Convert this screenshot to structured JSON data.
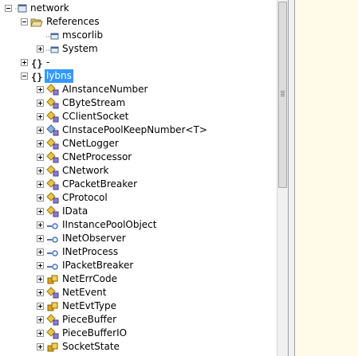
{
  "tree": {
    "rows": [
      {
        "level": 0,
        "expander": "minus",
        "icon": "assembly-icon",
        "label": "network"
      },
      {
        "level": 1,
        "expander": "minus",
        "icon": "folder-open-icon",
        "label": "References"
      },
      {
        "level": 2,
        "expander": "none",
        "icon": "reference-icon",
        "label": "mscorlib"
      },
      {
        "level": 2,
        "expander": "plus",
        "icon": "reference-icon",
        "label": "System"
      },
      {
        "level": 1,
        "expander": "plus",
        "icon": "namespace-icon",
        "label": "-"
      },
      {
        "level": 1,
        "expander": "minus",
        "icon": "namespace-icon",
        "label": "lybns",
        "selected": true
      },
      {
        "level": 2,
        "expander": "plus",
        "icon": "class-icon",
        "label": "AInstanceNumber"
      },
      {
        "level": 2,
        "expander": "plus",
        "icon": "class-icon",
        "label": "CByteStream"
      },
      {
        "level": 2,
        "expander": "plus",
        "icon": "class-icon",
        "label": "CClientSocket"
      },
      {
        "level": 2,
        "expander": "plus",
        "icon": "generic-class-icon",
        "label": "CInstacePoolKeepNumber<T>"
      },
      {
        "level": 2,
        "expander": "plus",
        "icon": "class-icon",
        "label": "CNetLogger"
      },
      {
        "level": 2,
        "expander": "plus",
        "icon": "class-icon",
        "label": "CNetProcessor"
      },
      {
        "level": 2,
        "expander": "plus",
        "icon": "class-icon",
        "label": "CNetwork"
      },
      {
        "level": 2,
        "expander": "plus",
        "icon": "class-icon",
        "label": "CPacketBreaker"
      },
      {
        "level": 2,
        "expander": "plus",
        "icon": "class-icon",
        "label": "CProtocol"
      },
      {
        "level": 2,
        "expander": "plus",
        "icon": "class-icon",
        "label": "IData"
      },
      {
        "level": 2,
        "expander": "plus",
        "icon": "interface-icon",
        "label": "IInstancePoolObject"
      },
      {
        "level": 2,
        "expander": "plus",
        "icon": "interface-icon",
        "label": "INetObserver"
      },
      {
        "level": 2,
        "expander": "plus",
        "icon": "interface-icon",
        "label": "INetProcess"
      },
      {
        "level": 2,
        "expander": "plus",
        "icon": "interface-icon",
        "label": "IPacketBreaker"
      },
      {
        "level": 2,
        "expander": "plus",
        "icon": "enum-icon",
        "label": "NetErrCode"
      },
      {
        "level": 2,
        "expander": "plus",
        "icon": "class-icon",
        "label": "NetEvent"
      },
      {
        "level": 2,
        "expander": "plus",
        "icon": "enum-icon",
        "label": "NetEvtType"
      },
      {
        "level": 2,
        "expander": "plus",
        "icon": "class-icon",
        "label": "PieceBuffer"
      },
      {
        "level": 2,
        "expander": "plus",
        "icon": "class-icon",
        "label": "PieceBufferIO"
      },
      {
        "level": 2,
        "expander": "plus",
        "icon": "enum-icon",
        "label": "SocketState"
      }
    ]
  },
  "colors": {
    "selection": "#3399ff",
    "right_pane": "#fffbe8",
    "class_diamond": "#e8c44a",
    "class_cube": "#8a7ec9",
    "interface": "#4a73b0",
    "enum": "#d9a520"
  }
}
